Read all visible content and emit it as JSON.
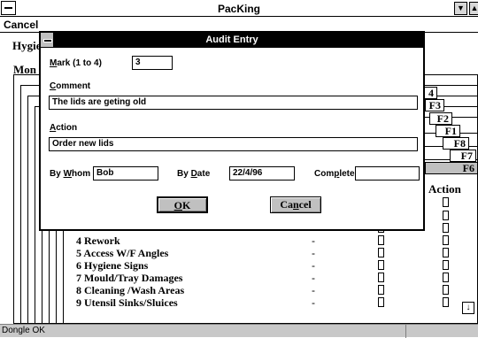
{
  "window": {
    "title": "PacKing",
    "minimize_glyph": "▼",
    "maximize_glyph": "▲"
  },
  "menubar": {
    "cancel": "Cancel"
  },
  "background": {
    "hygiene_label": "Hygie",
    "mon_label": "Mon",
    "f_tabs": [
      "4",
      "F3",
      "F2",
      "F1",
      "F8",
      "F7",
      "F6"
    ],
    "action_header": "Action",
    "rows": [
      {
        "label": "4  Rework",
        "value": "-"
      },
      {
        "label": "5  Access W/F Angles",
        "value": "-"
      },
      {
        "label": "6  Hygiene Signs",
        "value": "-"
      },
      {
        "label": "7  Mould/Tray Damages",
        "value": "-"
      },
      {
        "label": "8  Cleaning /Wash Areas",
        "value": "-"
      },
      {
        "label": "9  Utensil Sinks/Sluices",
        "value": "-"
      }
    ],
    "scroll_down_glyph": "↓"
  },
  "status": {
    "text": "Dongle OK"
  },
  "dialog": {
    "title": "Audit Entry",
    "mark": {
      "label_pre": "",
      "label_u": "M",
      "label_post": "ark (1 to 4)",
      "value": "3"
    },
    "comment": {
      "label_pre": "",
      "label_u": "C",
      "label_post": "omment",
      "value": "The lids are geting old"
    },
    "action": {
      "label_pre": "",
      "label_u": "A",
      "label_post": "ction",
      "value": "Order new lids"
    },
    "by_whom": {
      "label_pre": "By ",
      "label_u": "W",
      "label_post": "hom",
      "value": "Bob"
    },
    "by_date": {
      "label_pre": "By ",
      "label_u": "D",
      "label_post": "ate",
      "value": "22/4/96"
    },
    "complete": {
      "label_pre": "Com",
      "label_u": "p",
      "label_post": "lete",
      "value": ""
    },
    "ok": {
      "pre": "",
      "u": "O",
      "post": "K"
    },
    "cancel": {
      "pre": "Ca",
      "u": "n",
      "post": "cel"
    }
  }
}
